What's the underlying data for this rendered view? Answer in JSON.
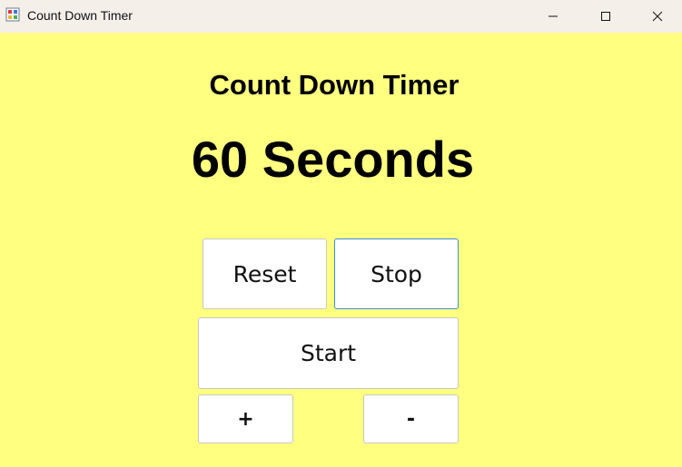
{
  "window": {
    "title": "Count Down Timer",
    "background_color": "#ffff80",
    "controls": {
      "minimize_icon": "minimize-icon",
      "maximize_icon": "maximize-icon",
      "close_icon": "close-icon"
    }
  },
  "main": {
    "heading": "Count Down Timer",
    "seconds_display": "60 Seconds"
  },
  "buttons": {
    "reset_label": "Reset",
    "stop_label": "Stop",
    "start_label": "Start",
    "plus_label": "+",
    "minus_label": "-",
    "focus_border_color": "#3c8fd6"
  }
}
